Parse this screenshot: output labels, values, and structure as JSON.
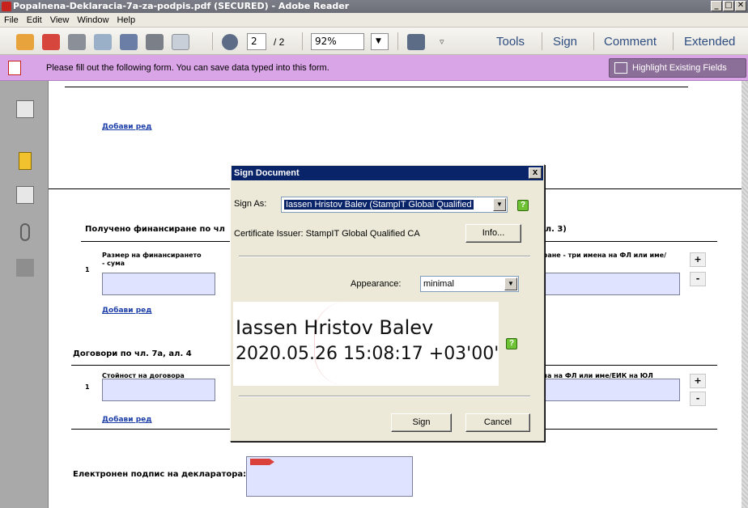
{
  "window": {
    "title": "Popalnena-Deklaracia-7a-za-podpis.pdf (SECURED) - Adobe Reader",
    "min": "_",
    "max": "□",
    "close": "✕"
  },
  "menu": [
    "File",
    "Edit",
    "View",
    "Window",
    "Help"
  ],
  "toolbar": {
    "page_current": "2",
    "page_total": "/ 2",
    "zoom": "92%",
    "tools": "Tools",
    "sign": "Sign",
    "comment": "Comment",
    "extended": "Extended"
  },
  "notice": {
    "text": "Please fill out the following form. You can save data typed into this form.",
    "button": "Highlight Existing Fields"
  },
  "doc": {
    "add_row": "Добави ред",
    "section1": "Получено финансиране по чл",
    "section1_right": "ал. 3)",
    "row_no": "1",
    "col_amount": "Размер на финансирането",
    "col_amount2": "- сума",
    "col_right1": "иране - три имена на ФЛ или име/",
    "section2": "Договори по чл. 7а, ал. 4",
    "col_contract": "Стойност на договора",
    "col_right2": "ена на ФЛ или име/ЕИК на ЮЛ",
    "plus": "+",
    "minus": "-",
    "signature_label": "Електронен подпис на декларатора:"
  },
  "dialog": {
    "title": "Sign Document",
    "close": "x",
    "sign_as_label": "Sign As:",
    "sign_as_value": "Iassen Hristov Balev (StampIT Global Qualified",
    "issuer": "Certificate Issuer: StampIT Global Qualified CA",
    "info_button": "Info...",
    "appearance_label": "Appearance:",
    "appearance_value": "minimal",
    "preview_name": "Iassen Hristov Balev",
    "preview_date": "2020.05.26 15:08:17 +03'00'",
    "help": "?",
    "sign_button": "Sign",
    "cancel_button": "Cancel"
  },
  "colors": {
    "notice_bg": "#d9a5e6",
    "dialog_title": "#0a246a",
    "field_bg": "#dfe3ff",
    "link": "#1d3fa9"
  }
}
